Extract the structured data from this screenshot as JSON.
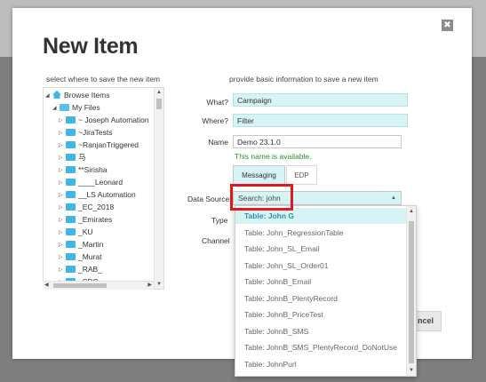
{
  "modal": {
    "title": "New Item",
    "close_symbol": "✖",
    "left_hint": "select where to save the new item",
    "right_hint": "provide basic information to save a new item"
  },
  "tree": {
    "root": "Browse Items",
    "my_files": "My Files",
    "items": [
      "~ Joseph Automation",
      "~JiraTests",
      "~RanjanTriggered",
      "马",
      "**Sirisha",
      "____Leonard",
      "__LS Automation",
      "_EC_2018",
      "_Emirates",
      "_KU",
      "_Martin",
      "_Murat",
      "_RAB_",
      "_SDC"
    ]
  },
  "form": {
    "what_label": "What?",
    "what_value": "Campaign",
    "where_label": "Where?",
    "where_value": "Filter",
    "name_label": "Name",
    "name_value": "Demo 23.1.0",
    "availability": "This name is available.",
    "tabs": [
      "Messaging",
      "EDP"
    ],
    "data_source_label": "Data Source",
    "data_source_value": "Search: john",
    "type_label": "Type",
    "channel_label": "Channel"
  },
  "dropdown": {
    "options": [
      "Table:  John G",
      "Table:  John_RegressionTable",
      "Table:  John_SL_Email",
      "Table:  John_SL_Order01",
      "Table:  JohnB_Email",
      "Table:  JohnB_PlentyRecord",
      "Table:  JohnB_PriceTest",
      "Table:  JohnB_SMS",
      "Table:  JohnB_SMS_PlentyRecord_DoNotUse",
      "Table:  JohnPurl"
    ]
  },
  "footer": {
    "cancel_label": "ncel"
  },
  "colors": {
    "accent_fill": "#d6f4f6",
    "folder": "#3fb6e4",
    "success": "#2e8b2e",
    "highlight_box": "#e0191a"
  }
}
